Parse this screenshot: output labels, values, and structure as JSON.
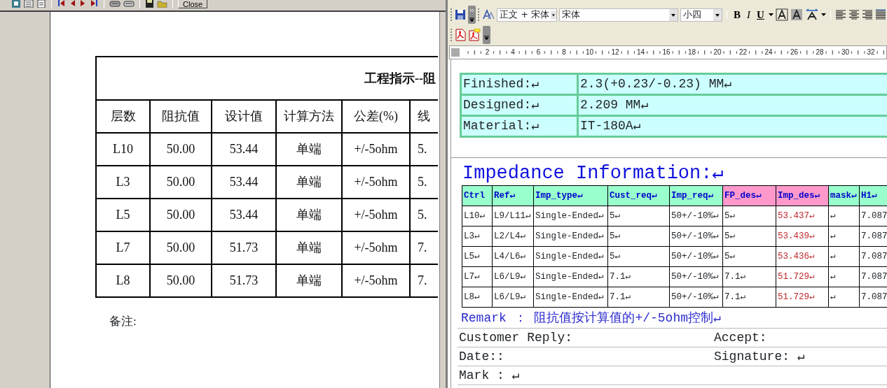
{
  "report_viewer": {
    "close_label": "Close",
    "report": {
      "title": "工程指示--阻",
      "columns": [
        "层数",
        "阻抗值",
        "设计值",
        "计算方法",
        "公差(%)",
        "线"
      ],
      "rows": [
        [
          "L10",
          "50.00",
          "53.44",
          "单端",
          "+/-5ohm",
          "5."
        ],
        [
          "L3",
          "50.00",
          "53.44",
          "单端",
          "+/-5ohm",
          "5."
        ],
        [
          "L5",
          "50.00",
          "53.44",
          "单端",
          "+/-5ohm",
          "5."
        ],
        [
          "L7",
          "50.00",
          "51.73",
          "单端",
          "+/-5ohm",
          "7."
        ],
        [
          "L8",
          "50.00",
          "51.73",
          "单端",
          "+/-5ohm",
          "7."
        ]
      ],
      "note_label": "备注:"
    }
  },
  "editor": {
    "toolbar": {
      "style": "正文 + 宋体",
      "font": "宋体",
      "size": "小四",
      "bold": "B",
      "italic": "I",
      "underline": "U"
    },
    "ruler_labels": [
      "2",
      "4",
      "6",
      "8",
      "10",
      "12",
      "14",
      "16",
      "18",
      "20",
      "22",
      "24",
      "26",
      "28",
      "30",
      "32"
    ],
    "spec_table": [
      {
        "label": "Finished:↵",
        "value": "2.3(+0.23/-0.23) MM↵"
      },
      {
        "label": "Designed:↵",
        "value": "2.209 MM↵"
      },
      {
        "label": "Material:↵",
        "value": "IT-180A↵"
      }
    ],
    "heading": "Impedance Information:↵",
    "impedance_table": {
      "columns": [
        {
          "label": "Ctrl",
          "color": "#99ffcc",
          "flagged": false
        },
        {
          "label": "Ref↵",
          "color": "#99ffcc",
          "flagged": false
        },
        {
          "label": "Imp_type↵",
          "color": "#99ffcc",
          "flagged": false
        },
        {
          "label": "Cust_req↵",
          "color": "#99ffcc",
          "flagged": false
        },
        {
          "label": "Imp_req↵",
          "color": "#99ffcc",
          "flagged": false
        },
        {
          "label": "FP_des↵",
          "color": "#ff99cc",
          "flagged": false
        },
        {
          "label": "Imp_des↵",
          "color": "#ff99cc",
          "flagged": true
        },
        {
          "label": "mask↵",
          "color": "#99ffcc",
          "flagged": false
        },
        {
          "label": "H1↵",
          "color": "#99ffcc",
          "flagged": false
        }
      ],
      "rows": [
        [
          "L10↵",
          "L9/L11↵",
          "Single-Ended↵",
          "5↵",
          "50+/-10%↵",
          "5↵",
          "53.437↵",
          "↵",
          "7.087"
        ],
        [
          "L3↵",
          "L2/L4↵",
          "Single-Ended↵",
          "5↵",
          "50+/-10%↵",
          "5↵",
          "53.439↵",
          "↵",
          "7.087"
        ],
        [
          "L5↵",
          "L4/L6↵",
          "Single-Ended↵",
          "5↵",
          "50+/-10%↵",
          "5↵",
          "53.436↵",
          "↵",
          "7.087"
        ],
        [
          "L7↵",
          "L6/L9↵",
          "Single-Ended↵",
          "7.1↵",
          "50+/-10%↵",
          "7.1↵",
          "51.729↵",
          "↵",
          "7.087"
        ],
        [
          "L8↵",
          "L6/L9↵",
          "Single-Ended↵",
          "7.1↵",
          "50+/-10%↵",
          "7.1↵",
          "51.729↵",
          "↵",
          "7.087"
        ]
      ]
    },
    "remark": "Remark ： 阻抗值按计算值的+/-5ohm控制↵",
    "reply_rows": [
      {
        "left": "Customer Reply:",
        "right": "Accept:"
      },
      {
        "left": "Date::",
        "right": "Signature: ↵"
      },
      {
        "left": "Mark : ↵"
      }
    ]
  }
}
